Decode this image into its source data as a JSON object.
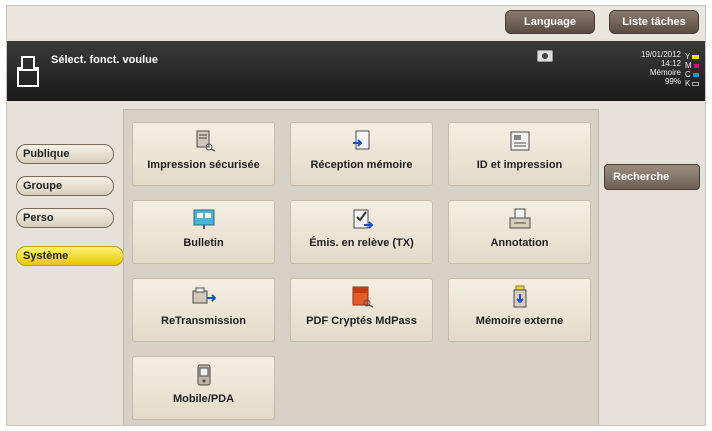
{
  "top_buttons": {
    "language": "Language",
    "task_list": "Liste tâches"
  },
  "status": {
    "title": "Sélect. fonct. voulue",
    "date": "19/01/2012",
    "time": "14:12",
    "memory_label": "Mémoire",
    "memory_value": "99%",
    "toners": [
      {
        "letter": "Y",
        "color": "#f2e600"
      },
      {
        "letter": "M",
        "color": "#e6007e"
      },
      {
        "letter": "C",
        "color": "#00a0e9"
      },
      {
        "letter": "K",
        "color": "#222222"
      }
    ]
  },
  "tabs": [
    {
      "label": "Publique"
    },
    {
      "label": "Groupe"
    },
    {
      "label": "Perso"
    },
    {
      "label": "Système",
      "active": true
    }
  ],
  "functions": [
    {
      "label": "Impression sécurisée",
      "icon": "secure-print-icon"
    },
    {
      "label": "Réception mémoire",
      "icon": "memory-receive-icon"
    },
    {
      "label": "ID et impression",
      "icon": "id-print-icon"
    },
    {
      "label": "Bulletin",
      "icon": "bulletin-icon"
    },
    {
      "label": "Émis. en relève (TX)",
      "icon": "polling-tx-icon"
    },
    {
      "label": "Annotation",
      "icon": "annotation-icon"
    },
    {
      "label": "ReTransmission",
      "icon": "retransmission-icon"
    },
    {
      "label": "PDF Cryptés MdPass",
      "icon": "encrypted-pdf-icon"
    },
    {
      "label": "Mémoire externe",
      "icon": "external-memory-icon"
    },
    {
      "label": "Mobile/PDA",
      "icon": "mobile-pda-icon"
    }
  ],
  "search_button": "Recherche",
  "colors": {
    "active_tab": "#f2d800",
    "status_bar": "#2a2a2a",
    "top_button": "#6e5f54"
  }
}
